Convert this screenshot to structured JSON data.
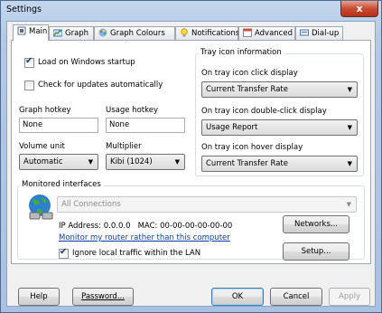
{
  "window": {
    "title": "Settings",
    "close": "x"
  },
  "tabs": [
    {
      "label": "Main",
      "icon": "main-tab-icon"
    },
    {
      "label": "Graph",
      "icon": "graph-icon"
    },
    {
      "label": "Graph Colours",
      "icon": "palette-icon"
    },
    {
      "label": "Notifications",
      "icon": "lightbulb-icon"
    },
    {
      "label": "Advanced",
      "icon": "calendar-icon"
    },
    {
      "label": "Dial-up",
      "icon": "dialup-icon"
    }
  ],
  "main": {
    "load_on_startup": {
      "label": "Load on Windows startup",
      "checked": true
    },
    "check_updates": {
      "label": "Check for updates automatically",
      "checked": false
    },
    "graph_hotkey": {
      "label": "Graph hotkey",
      "value": "None"
    },
    "usage_hotkey": {
      "label": "Usage hotkey",
      "value": "None"
    },
    "volume_unit": {
      "label": "Volume unit",
      "value": "Automatic"
    },
    "multiplier": {
      "label": "Multiplier",
      "value": "Kibi (1024)"
    },
    "tray": {
      "group_label": "Tray icon information",
      "click": {
        "label": "On tray icon click display",
        "value": "Current Transfer Rate"
      },
      "double_click": {
        "label": "On tray icon double-click display",
        "value": "Usage Report"
      },
      "hover": {
        "label": "On tray icon hover display",
        "value": "Current Transfer Rate"
      }
    },
    "monitored": {
      "group_label": "Monitored interfaces",
      "connection": "All Connections",
      "ip_info": "IP Address: 0.0.0.0   MAC: 00-00-00-00-00-00",
      "router_link": "Monitor my router rather than this computer",
      "ignore_lan": {
        "label": "Ignore local traffic within the LAN",
        "checked": true
      },
      "networks_button": "Networks...",
      "setup_button": "Setup..."
    }
  },
  "footer": {
    "help": "Help",
    "password": "Password...",
    "ok": "OK",
    "cancel": "Cancel",
    "apply": "Apply"
  }
}
